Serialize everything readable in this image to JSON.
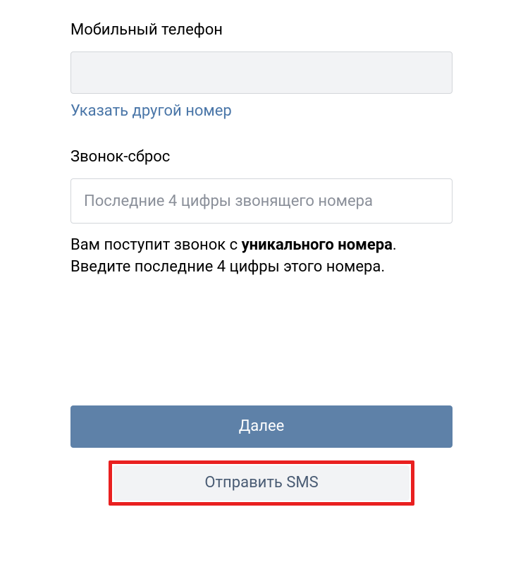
{
  "phone": {
    "label": "Мобильный телефон",
    "value": "",
    "change_link": "Указать другой номер"
  },
  "call_reset": {
    "label": "Звонок-сброс",
    "placeholder": "Последние 4 цифры звонящего номера",
    "help_text_prefix": "Вам поступит звонок с ",
    "help_text_bold": "уникального номера",
    "help_text_suffix": ". Введите последние 4 цифры этого номера."
  },
  "buttons": {
    "next": "Далее",
    "send_sms": "Отправить SMS"
  }
}
